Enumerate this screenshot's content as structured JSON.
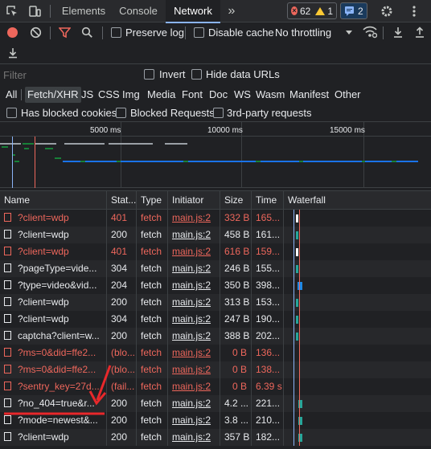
{
  "tabs": {
    "elements": "Elements",
    "console": "Console",
    "network": "Network",
    "more": "»",
    "errors_count": "62",
    "warnings_count": "1",
    "messages_count": "2"
  },
  "toolbar": {
    "preserve_log": "Preserve log",
    "disable_cache": "Disable cache",
    "throttling": "No throttling"
  },
  "filter": {
    "placeholder": "Filter",
    "invert": "Invert",
    "hide_data_urls": "Hide data URLs"
  },
  "types": [
    "All",
    "Fetch/XHR",
    "JS",
    "CSS",
    "Img",
    "Media",
    "Font",
    "Doc",
    "WS",
    "Wasm",
    "Manifest",
    "Other"
  ],
  "options": {
    "blocked_cookies": "Has blocked cookies",
    "blocked_requests": "Blocked Requests",
    "third_party": "3rd-party requests"
  },
  "overview": {
    "ticks": [
      "5000 ms",
      "10000 ms",
      "15000 ms"
    ]
  },
  "columns": {
    "name": "Name",
    "status": "Stat...",
    "type": "Type",
    "initiator": "Initiator",
    "size": "Size",
    "time": "Time",
    "waterfall": "Waterfall"
  },
  "requests": [
    {
      "name": "?client=wdp",
      "status": "401",
      "type": "fetch",
      "initiator": "main.js:2",
      "size": "332 B",
      "time": "165...",
      "error": true
    },
    {
      "name": "?client=wdp",
      "status": "200",
      "type": "fetch",
      "initiator": "main.js:2",
      "size": "458 B",
      "time": "161...",
      "error": false
    },
    {
      "name": "?client=wdp",
      "status": "401",
      "type": "fetch",
      "initiator": "main.js:2",
      "size": "616 B",
      "time": "159...",
      "error": true
    },
    {
      "name": "?pageType=vide...",
      "status": "304",
      "type": "fetch",
      "initiator": "main.js:2",
      "size": "246 B",
      "time": "155...",
      "error": false
    },
    {
      "name": "?type=video&vid...",
      "status": "204",
      "type": "fetch",
      "initiator": "main.js:2",
      "size": "350 B",
      "time": "398...",
      "error": false
    },
    {
      "name": "?client=wdp",
      "status": "200",
      "type": "fetch",
      "initiator": "main.js:2",
      "size": "313 B",
      "time": "153...",
      "error": false
    },
    {
      "name": "?client=wdp",
      "status": "304",
      "type": "fetch",
      "initiator": "main.js:2",
      "size": "247 B",
      "time": "190...",
      "error": false
    },
    {
      "name": "captcha?client=w...",
      "status": "200",
      "type": "fetch",
      "initiator": "main.js:2",
      "size": "388 B",
      "time": "202...",
      "error": false
    },
    {
      "name": "?ms=0&did=ffe2...",
      "status": "(blo...",
      "type": "fetch",
      "initiator": "main.js:2",
      "size": "0 B",
      "time": "136...",
      "error": true
    },
    {
      "name": "?ms=0&did=ffe2...",
      "status": "(blo...",
      "type": "fetch",
      "initiator": "main.js:2",
      "size": "0 B",
      "time": "138...",
      "error": true
    },
    {
      "name": "?sentry_key=27d...",
      "status": "(fail...",
      "type": "fetch",
      "initiator": "main.js:2",
      "size": "0 B",
      "time": "6.39 s",
      "error": true
    },
    {
      "name": "?no_404=true&r...",
      "status": "200",
      "type": "fetch",
      "initiator": "main.js:2",
      "size": "4.2 ...",
      "time": "221...",
      "error": false
    },
    {
      "name": "?mode=newest&...",
      "status": "200",
      "type": "fetch",
      "initiator": "main.js:2",
      "size": "3.8 ...",
      "time": "210...",
      "error": false
    },
    {
      "name": "?client=wdp",
      "status": "200",
      "type": "fetch",
      "initiator": "main.js:2",
      "size": "357 B",
      "time": "182...",
      "error": false
    }
  ],
  "colors": {
    "accent": "#8ab4f8",
    "error": "#ee675c",
    "warning": "#fcc934",
    "annotation": "#e8282b"
  }
}
